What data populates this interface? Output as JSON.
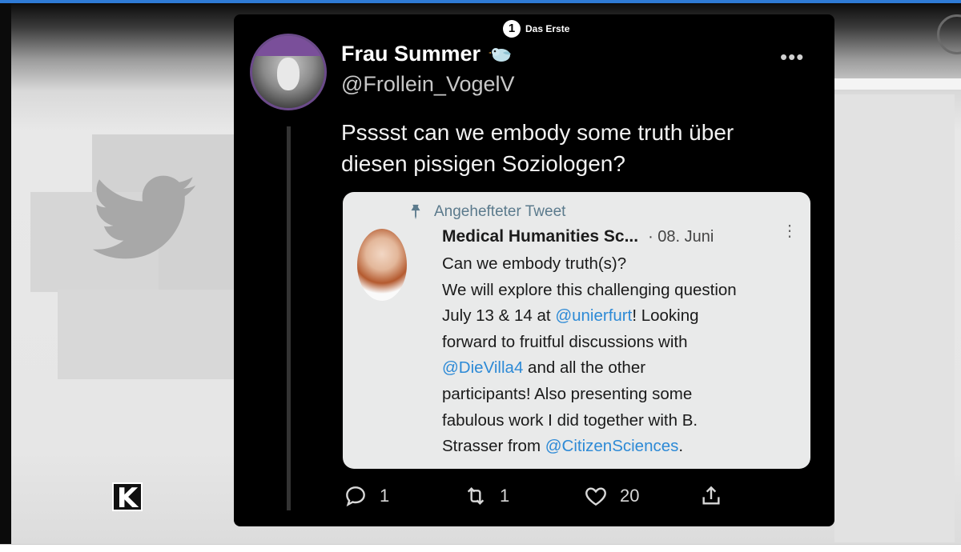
{
  "broadcaster": {
    "logo_mark": "1",
    "name": "Das Erste"
  },
  "corner_logo": "K",
  "tweet": {
    "display_name": "Frau Summer",
    "handle": "@Frollein_VogelV",
    "more_label": "•••",
    "text_lines": [
      "Psssst can we embody some truth über",
      "diesen pissigen Soziologen?"
    ],
    "quoted": {
      "pinned_label": "Angehefteter Tweet",
      "author": "Medical Humanities Sc...",
      "date": "· 08. Juni",
      "more_label": "⋮",
      "body": [
        {
          "text": "Can we embody truth(s)?"
        },
        {
          "text": "We will explore this challenging question"
        },
        {
          "pre": "July 13 & 14 at ",
          "link": "@unierfurt",
          "post": "! Looking"
        },
        {
          "text": "forward to fruitful discussions with"
        },
        {
          "pre": "",
          "link": "@DieVilla4",
          "post": " and all the other"
        },
        {
          "text": "participants! Also presenting some"
        },
        {
          "text": "fabulous work I did together with B."
        },
        {
          "pre": "Strasser from ",
          "link": "@CitizenSciences",
          "post": "."
        }
      ]
    },
    "actions": {
      "replies": "1",
      "retweets": "1",
      "likes": "20",
      "share": ""
    }
  },
  "colors": {
    "tweet_bg": "#000000",
    "link": "#2d8ad6",
    "quote_bg": "#e9eaea",
    "top_accent": "#2f7bd6"
  },
  "icons": [
    "reply-icon",
    "retweet-icon",
    "like-icon",
    "share-icon",
    "pin-icon",
    "bird-badge-icon"
  ]
}
